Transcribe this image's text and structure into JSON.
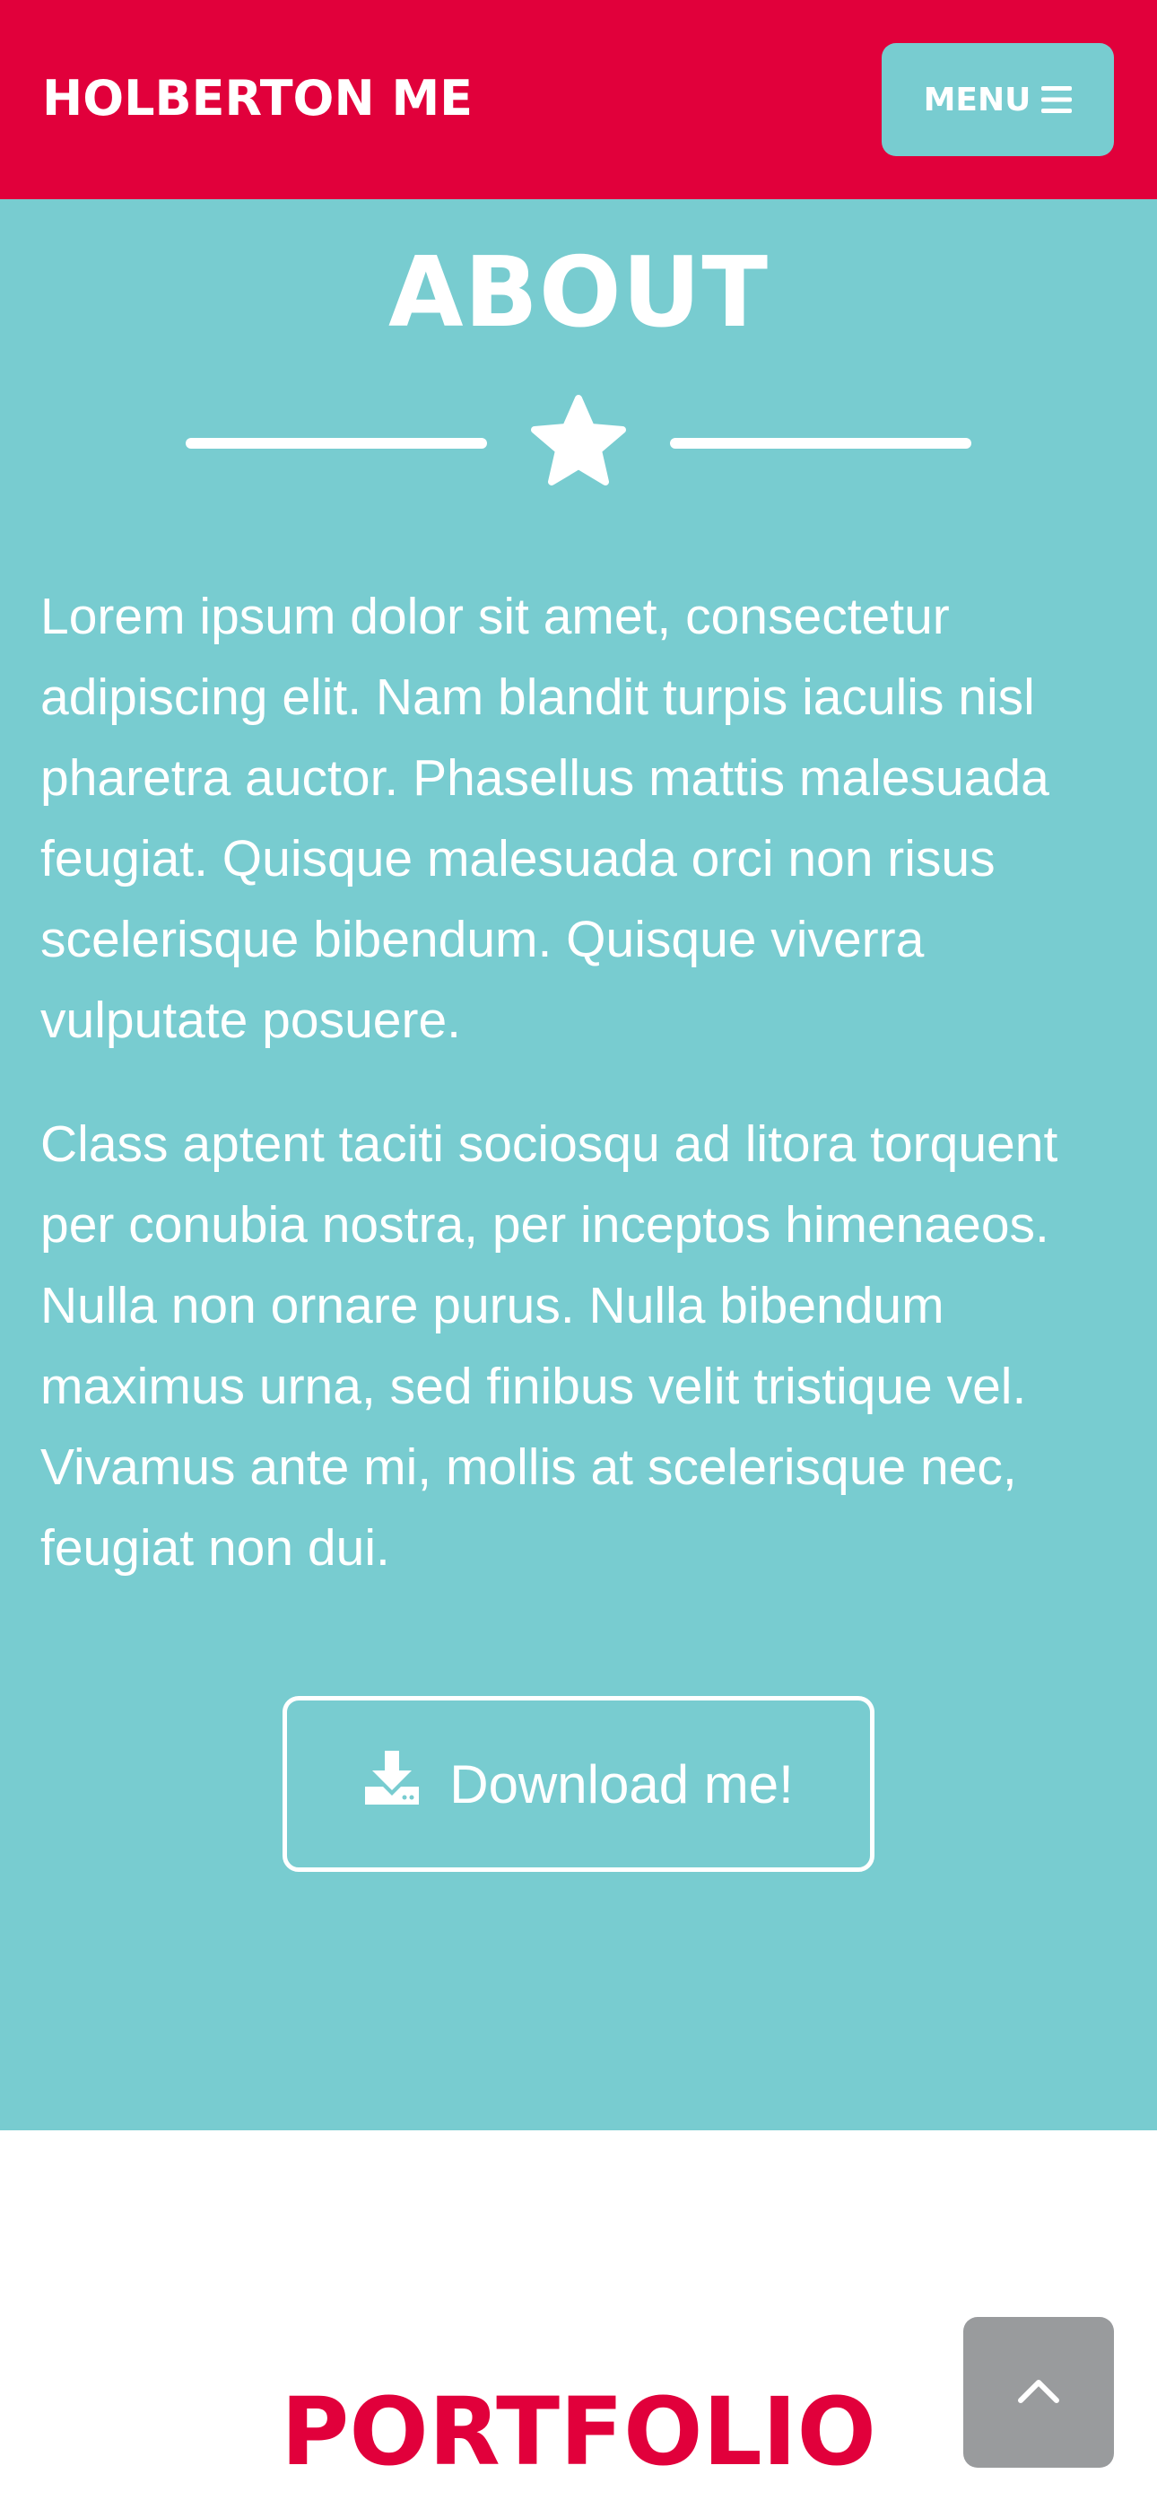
{
  "header": {
    "brand": "HOLBERTON ME",
    "menu_label": "MENU",
    "menu_icon": "hamburger-icon"
  },
  "about": {
    "title": "ABOUT",
    "divider_icon": "star-icon",
    "paragraphs": [
      "Lorem ipsum dolor sit amet, consectetur adipiscing elit. Nam blandit turpis iaculis nisl pharetra auctor. Phasellus mattis malesuada feugiat. Quisque malesuada orci non risus scelerisque bibendum. Quisque viverra vulputate posuere.",
      "Class aptent taciti sociosqu ad litora torquent per conubia nostra, per inceptos himenaeos. Nulla non ornare purus. Nulla bibendum maximus urna, sed finibus velit tristique vel. Vivamus ante mi, mollis at scelerisque nec, feugiat non dui."
    ],
    "download_label": "Download me!",
    "download_icon": "download-icon"
  },
  "portfolio": {
    "title": "PORTFOLIO"
  },
  "scroll_top": {
    "icon": "chevron-up-icon"
  },
  "colors": {
    "primary": "#e1003b",
    "teal": "#78ccd0",
    "gray": "#999b9d",
    "white": "#ffffff"
  }
}
